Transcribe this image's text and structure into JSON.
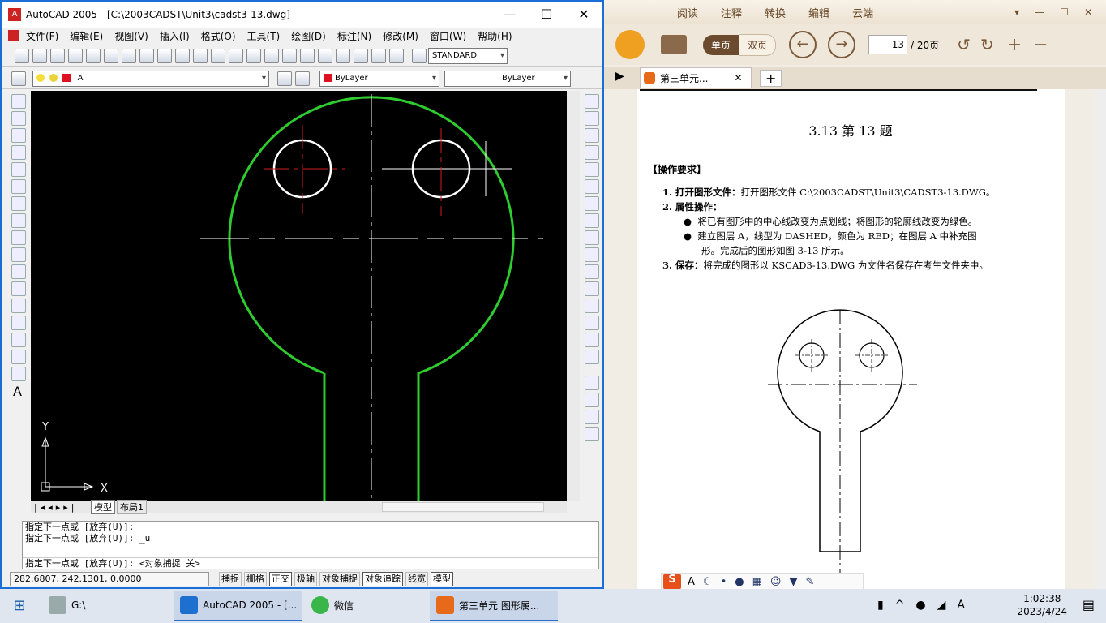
{
  "autocad": {
    "title": "AutoCAD 2005 - [C:\\2003CADST\\Unit3\\cadst3-13.dwg]",
    "menus": [
      "文件(F)",
      "编辑(E)",
      "视图(V)",
      "插入(I)",
      "格式(O)",
      "工具(T)",
      "绘图(D)",
      "标注(N)",
      "修改(M)",
      "窗口(W)",
      "帮助(H)"
    ],
    "text_style": "STANDARD",
    "layer": "A",
    "color": "ByLayer",
    "linetype": "ByLayer",
    "tabs": [
      "模型",
      "布局1"
    ],
    "command_lines": [
      "指定下一点或 [放弃(U)]:",
      "指定下一点或 [放弃(U)]: _u"
    ],
    "command_prompt": "指定下一点或 [放弃(U)]:  <对象捕捉 关>",
    "coords": "282.6807, 242.1301, 0.0000",
    "status_buttons": [
      "捕捉",
      "栅格",
      "正交",
      "极轴",
      "对象捕捉",
      "对象追踪",
      "线宽",
      "模型"
    ],
    "ucs_x": "X",
    "ucs_y": "Y"
  },
  "reader": {
    "tabs": [
      "阅读",
      "注释",
      "转换",
      "编辑",
      "云端"
    ],
    "single_page": "单页",
    "double_page": "双页",
    "page_current": "13",
    "page_total": "/ 20页",
    "doc_tab": "第三单元...",
    "heading": "3.13   第 13 题",
    "requirements_title": "【操作要求】",
    "item1_label": "1. 打开图形文件：",
    "item1_text": "打开图形文件 C:\\2003CADST\\Unit3\\CADST3-13.DWG。",
    "item2_label": "2. 属性操作：",
    "bullet1": "将已有图形中的中心线改变为点划线；将图形的轮廓线改变为绿色。",
    "bullet2_a": "建立图层 A，线型为 DASHED，颜色为 RED；在图层 A 中补充图",
    "bullet2_b": "形。完成后的图形如图 3-13 所示。",
    "item3_label": "3. 保存：",
    "item3_text": "将完成的图形以 KSCAD3-13.DWG 为文件名保存在考生文件夹中。"
  },
  "taskbar": {
    "items": [
      "G:\\",
      "AutoCAD 2005 - [...",
      "微信",
      "第三单元  图形属..."
    ],
    "time": "1:02:38",
    "date": "2023/4/24"
  },
  "colors": {
    "outline": "#2ecc2e",
    "center_red": "#d21b1b"
  }
}
